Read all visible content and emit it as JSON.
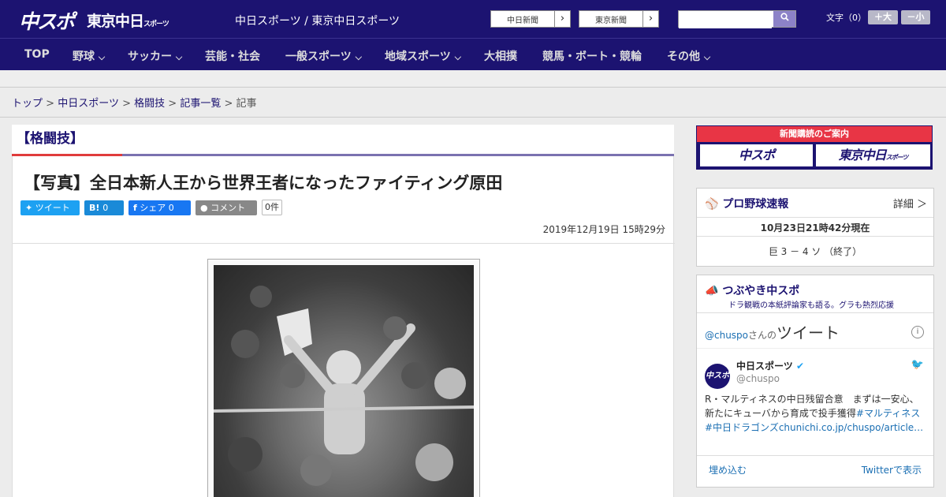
{
  "header": {
    "logo1": "中スポ",
    "logo2": "東京中日",
    "logo2_sub": "スポーツ",
    "site_name": "中日スポーツ / 東京中日スポーツ",
    "ext1": "中日新聞",
    "ext2": "東京新聞",
    "search_placeholder": "",
    "fontsize_label": "文字（0）",
    "bigger": "＋大",
    "smaller": "－小"
  },
  "nav": [
    {
      "label": "TOP"
    },
    {
      "label": "野球"
    },
    {
      "label": "サッカー"
    },
    {
      "label": "芸能・社会"
    },
    {
      "label": "一般スポーツ"
    },
    {
      "label": "地域スポーツ"
    },
    {
      "label": "大相撲"
    },
    {
      "label": "競馬・ボート・競輪"
    },
    {
      "label": "その他"
    }
  ],
  "breadcrumb": {
    "top": "トップ",
    "chunichi": "中日スポーツ",
    "category": "格闘技",
    "list": "記事一覧",
    "current": "記事",
    "sep": ">"
  },
  "category_heading": "【格闘技】",
  "article": {
    "title": "【写真】全日本新人王から世界王者になったファイティング原田",
    "share": {
      "tweet": "ツイート",
      "hatena": "B!",
      "hatena_count": "0",
      "facebook": "シェア",
      "facebook_count": "0",
      "comment": "コメント",
      "comment_count": "0件"
    },
    "date": "2019年12月19日 15時29分"
  },
  "sidebar": {
    "subscription": {
      "title": "新聞購読のご案内",
      "left": "中スポ",
      "right": "東京中日",
      "right_sub": "スポーツ"
    },
    "baseball": {
      "title": "プロ野球速報",
      "detail": "詳細 ＞",
      "time": "10月23日21時42分現在",
      "score": "巨 3 － 4 ソ （終了）"
    },
    "tweets": {
      "title": "つぶやき中スポ",
      "subtitle": "ドラ観戦の本紙評論家も語る。グラも熱烈応援",
      "handle_prefix": "@chuspo",
      "handle_suffix": "さんの",
      "label": "ツイート",
      "user": "中日スポーツ",
      "user_handle": "@chuspo",
      "avatar_text": "中スポ",
      "tweet_text": "R・マルティネスの中日残留合意　まずは一安心、新たにキューバから育成で投手獲得",
      "tweet_tag": "#マルティネス",
      "tweet_tag2": "#中日ドラゴンズ",
      "tweet_link": "chunichi.co.jp/chuspo/article…",
      "embed": "埋め込む",
      "view": "Twitterで表示"
    }
  }
}
